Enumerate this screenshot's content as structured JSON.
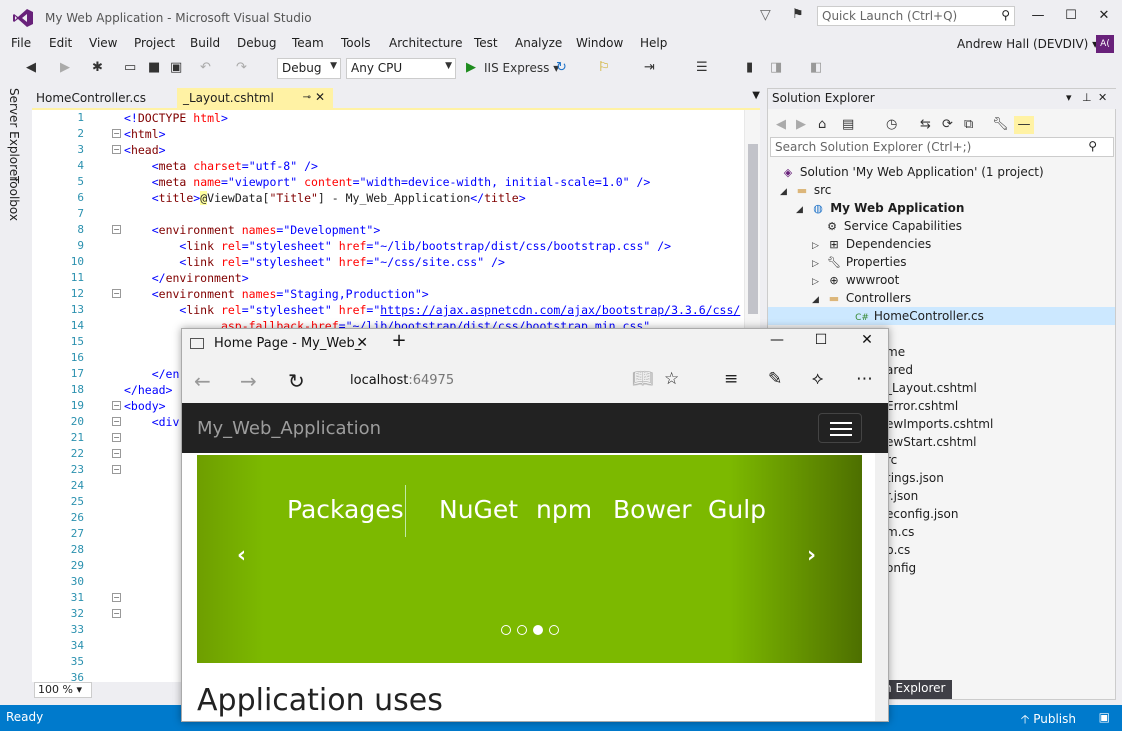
{
  "window": {
    "title": "My Web Application - Microsoft Visual Studio",
    "quick_launch_placeholder": "Quick Launch (Ctrl+Q)"
  },
  "menu": [
    "File",
    "Edit",
    "View",
    "Project",
    "Build",
    "Debug",
    "Team",
    "Tools",
    "Architecture",
    "Test",
    "Analyze",
    "Window",
    "Help"
  ],
  "user": {
    "name": "Andrew Hall (DEVDIV)",
    "initials": "A("
  },
  "toolbar": {
    "config": "Debug",
    "platform": "Any CPU",
    "run_label": "IIS Express"
  },
  "side_tabs": [
    "Server Explorer",
    "Toolbox"
  ],
  "doc_tabs": [
    {
      "label": "HomeController.cs"
    },
    {
      "label": "_Layout.cshtml",
      "active": true
    }
  ],
  "editor": {
    "line_numbers": [
      "1",
      "2",
      "3",
      "4",
      "5",
      "6",
      "7",
      "8",
      "9",
      "10",
      "11",
      "12",
      "13",
      "14",
      "15",
      "16",
      "17",
      "18",
      "19",
      "20",
      "21",
      "22",
      "23",
      "24",
      "25",
      "26",
      "27",
      "28",
      "29",
      "30",
      "31",
      "32",
      "33",
      "34",
      "35",
      "36"
    ],
    "visible_fragments": {
      "l17": "</en",
      "l18": "</head>",
      "l19": "<body>",
      "l20": "<div"
    },
    "zoom": "100 %"
  },
  "solution_explorer": {
    "title": "Solution Explorer",
    "search_placeholder": "Search Solution Explorer (Ctrl+;)",
    "items": [
      {
        "label": "Solution 'My Web Application' (1 project)",
        "icon": "solution-icon"
      },
      {
        "label": "src",
        "icon": "folder-icon"
      },
      {
        "label": "My Web Application",
        "icon": "web-project-icon"
      },
      {
        "label": "Service Capabilities",
        "icon": "service-icon"
      },
      {
        "label": "Dependencies",
        "icon": "dependencies-icon"
      },
      {
        "label": "Properties",
        "icon": "wrench-icon"
      },
      {
        "label": "wwwroot",
        "icon": "globe-icon"
      },
      {
        "label": "Controllers",
        "icon": "folder-icon"
      },
      {
        "label": "HomeController.cs",
        "icon": "csharp-file-icon"
      }
    ],
    "partial_items": [
      "me",
      "ared",
      "_Layout.cshtml",
      "Error.cshtml",
      "ewImports.cshtml",
      "ewStart.cshtml",
      "rc",
      "tings.json",
      "r.json",
      "econfig.json",
      "m.cs",
      "p.cs",
      "onfig"
    ],
    "bottom_tab": "m Explorer"
  },
  "status": {
    "text": "Ready",
    "publish": "Publish"
  },
  "browser": {
    "tab_title": "Home Page - My_Web_",
    "url_host": "localhost",
    "url_port": ":64975",
    "brand": "My_Web_Application",
    "carousel": {
      "first": "Packages",
      "keywords": [
        "NuGet",
        "npm",
        "Bower",
        "Gulp"
      ],
      "active_dot": 2,
      "dot_count": 4
    },
    "heading": "Application uses"
  }
}
